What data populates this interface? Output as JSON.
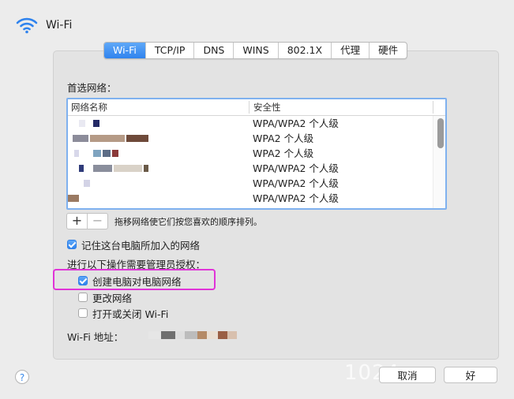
{
  "header": {
    "title": "Wi-Fi",
    "icon": "wifi-icon"
  },
  "tabs": [
    "Wi-Fi",
    "TCP/IP",
    "DNS",
    "WINS",
    "802.1X",
    "代理",
    "硬件"
  ],
  "preferred_networks": {
    "label": "首选网络：",
    "columns": {
      "name": "网络名称",
      "security": "安全性"
    },
    "rows": [
      {
        "name": "",
        "security": "WPA/WPA2 个人级"
      },
      {
        "name": "",
        "security": "WPA2 个人级"
      },
      {
        "name": "",
        "security": "WPA2 个人级"
      },
      {
        "name": "",
        "security": "WPA/WPA2 个人级"
      },
      {
        "name": "",
        "security": "WPA/WPA2 个人级"
      },
      {
        "name": "",
        "security": "WPA/WPA2 个人级"
      }
    ]
  },
  "controls": {
    "add": "+",
    "remove": "−",
    "hint": "拖移网络使它们按您喜欢的顺序排列。"
  },
  "remember": {
    "label": "记住这台电脑所加入的网络",
    "checked": true
  },
  "admin": {
    "label": "进行以下操作需要管理员授权：",
    "options": [
      {
        "label": "创建电脑对电脑网络",
        "checked": true
      },
      {
        "label": "更改网络",
        "checked": false
      },
      {
        "label": "打开或关闭 Wi-Fi",
        "checked": false
      }
    ]
  },
  "address": {
    "label": "Wi-Fi 地址："
  },
  "footer": {
    "help": "?",
    "cancel": "取消",
    "ok": "好"
  },
  "watermark": "1024",
  "colors": {
    "accent": "#2f83ee",
    "highlight": "#e034d8"
  }
}
